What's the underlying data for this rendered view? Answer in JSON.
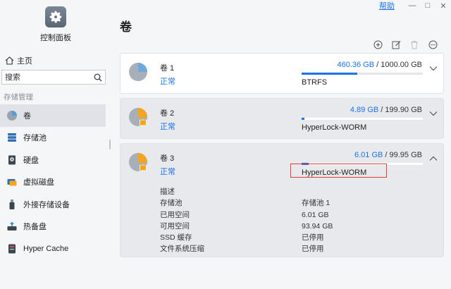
{
  "window": {
    "help": "帮助",
    "minimize": "—",
    "maximize": "□",
    "close": "✕"
  },
  "sidebar": {
    "app_title": "控制面板",
    "home": "主页",
    "search_placeholder": "搜索",
    "section": "存储管理",
    "items": [
      {
        "label": "卷",
        "icon": "volume-pie-icon",
        "active": true
      },
      {
        "label": "存储池",
        "icon": "storage-pool-icon",
        "active": false
      },
      {
        "label": "硬盘",
        "icon": "hard-disk-icon",
        "active": false
      },
      {
        "label": "虚拟磁盘",
        "icon": "virtual-disk-icon",
        "active": false
      },
      {
        "label": "外接存储设备",
        "icon": "usb-drive-icon",
        "active": false
      },
      {
        "label": "热备盘",
        "icon": "hot-spare-icon",
        "active": false
      },
      {
        "label": "Hyper Cache",
        "icon": "hyper-cache-icon",
        "active": false
      }
    ]
  },
  "main": {
    "title": "卷",
    "toolbar": [
      "add-icon",
      "edit-icon",
      "delete-icon",
      "more-icon"
    ],
    "volumes": [
      {
        "name": "卷 1",
        "status": "正常",
        "used": "460.36 GB",
        "sep": " / ",
        "total": "1000.00 GB",
        "fraction": 0.46,
        "fs": "BTRFS",
        "locked": false,
        "expanded": false
      },
      {
        "name": "卷 2",
        "status": "正常",
        "used": "4.89 GB",
        "sep": " / ",
        "total": "199.90 GB",
        "fraction": 0.025,
        "fs": "HyperLock-WORM",
        "locked": true,
        "expanded": false
      },
      {
        "name": "卷 3",
        "status": "正常",
        "used": "6.01 GB",
        "sep": " / ",
        "total": "99.95 GB",
        "fraction": 0.06,
        "fs": "HyperLock-WORM",
        "locked": true,
        "expanded": true
      }
    ],
    "details": {
      "heading": "描述",
      "rows": [
        {
          "label": "存储池",
          "value": "存储池 1"
        },
        {
          "label": "已用空间",
          "value": "6.01 GB"
        },
        {
          "label": "可用空间",
          "value": "93.94 GB"
        },
        {
          "label": "SSD 缓存",
          "value": "已停用"
        },
        {
          "label": "文件系统压缩",
          "value": "已停用"
        }
      ]
    },
    "colors": {
      "accent": "#1a73e8",
      "pie_blue": "#6fa8dc",
      "pie_orange": "#f4a51c",
      "highlight": "#e03a3a"
    }
  }
}
